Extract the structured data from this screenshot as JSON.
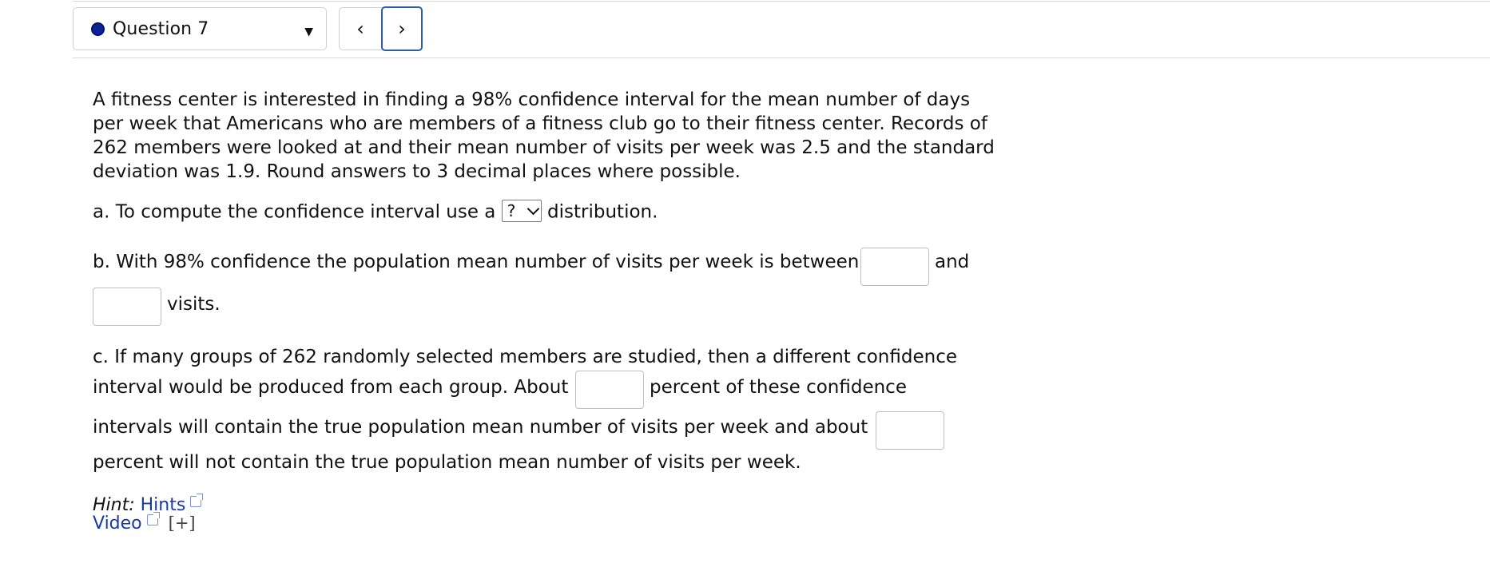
{
  "header": {
    "question_label": "Question 7",
    "prev_label": "‹",
    "next_label": "›",
    "dropdown_caret": "▼"
  },
  "question": {
    "intro_lines": [
      "A fitness center is interested in finding a 98% confidence interval for the mean number of days",
      "per week that Americans who are members of a fitness club go to their fitness center. Records of",
      "262 members were looked at and their mean number of visits per week was 2.5 and the standard",
      "deviation was 1.9. Round answers to 3 decimal places where possible."
    ],
    "part_a": {
      "before": "a. To compute the confidence interval use a",
      "select_value": "?",
      "after": "distribution."
    },
    "part_b": {
      "before": "b. With 98% confidence the population mean number of visits per week is between",
      "middle": "and",
      "after": "visits.",
      "input1_value": "",
      "input2_value": ""
    },
    "part_c": {
      "line1": "c. If many groups of 262 randomly selected members are studied, then a different confidence",
      "line2_before": "interval would be produced from each group. About",
      "line2_after": "percent of these confidence",
      "line3_before": "intervals will contain the true population mean number of visits per week and about",
      "line4": "percent will not contain the true population mean number of visits per week.",
      "input1_value": "",
      "input2_value": ""
    }
  },
  "hints": {
    "hint_prefix": "Hint:",
    "hints_link": "Hints",
    "video_link": "Video",
    "expand_label": "[+]"
  },
  "colors": {
    "dot": "#0d2299",
    "link": "#1a3aa3",
    "next_border": "#2f5da8"
  }
}
